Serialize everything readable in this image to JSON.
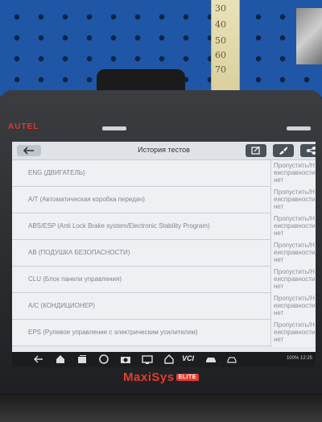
{
  "background": {
    "ruler_ticks": [
      "30",
      "40",
      "50",
      "60",
      "70"
    ]
  },
  "device": {
    "brand_top": "AUTEL",
    "brand_bottom": "MaxiSys",
    "brand_tag": "ELITE",
    "accent_color": "#e63c2c"
  },
  "header": {
    "title": "История тестов",
    "back_icon": "arrow-left-icon",
    "buttons": [
      "edit-icon",
      "brush-icon",
      "share-icon"
    ]
  },
  "rows": [
    {
      "name": "ENG (ДВИГАТЕЛЬ)",
      "status": "Пропустить/Неисправности нет"
    },
    {
      "name": "A/T (Автоматическая коробка передач)",
      "status": "Пропустить/Неисправности нет"
    },
    {
      "name": "ABS/ESP (Anti Lock Brake system/Electronic Stability Program)",
      "status": "Пропустить/Неисправности нет"
    },
    {
      "name": "AB (ПОДУШКА БЕЗОПАСНОСТИ)",
      "status": "Пропустить/Неисправности нет"
    },
    {
      "name": "CLU (Блок панели управления)",
      "status": "Пропустить/Неисправности нет"
    },
    {
      "name": "A/C (КОНДИЦИОНЕР)",
      "status": "Пропустить/Неисправности нет"
    },
    {
      "name": "EPS (Рулевое управление с электрическим усилителем)",
      "status": "Пропустить/Неисправности нет"
    }
  ],
  "navbar": {
    "vci_label": "VCI",
    "status_text": "100% 12:25"
  }
}
